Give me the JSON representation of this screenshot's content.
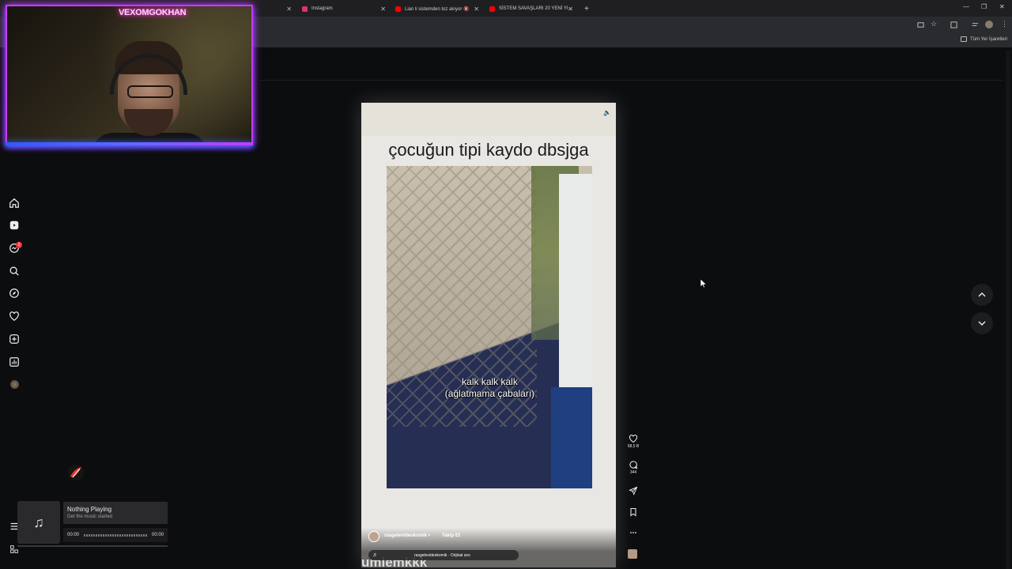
{
  "browser": {
    "tabs": [
      {
        "label": "Instagram",
        "color": "#e1306c"
      },
      {
        "label": "Lian li sistemden toz akıyor 🔇",
        "color": "#ff0000"
      },
      {
        "label": "SİSTEM SAVAŞLARI 20 YENİ YI...",
        "color": "#ff0000"
      }
    ],
    "new_tab": "+",
    "bookmarks_label": "Tüm Yer İşaretleri"
  },
  "webcam": {
    "title": "VEXOMGOKHAN"
  },
  "nav": {
    "items": [
      {
        "icon": "home-icon"
      },
      {
        "icon": "reels-icon"
      },
      {
        "icon": "messages-icon",
        "badge": "2"
      },
      {
        "icon": "search-icon"
      },
      {
        "icon": "explore-icon"
      },
      {
        "icon": "heart-icon"
      },
      {
        "icon": "create-icon"
      },
      {
        "icon": "dashboard-icon"
      },
      {
        "icon": "profile-avatar"
      }
    ],
    "more_icon": "menu-icon"
  },
  "music": {
    "title": "Nothing Playing",
    "subtitle": "Get the music started",
    "time_current": "00:00",
    "time_total": "00:00"
  },
  "reel": {
    "caption": "çocuğun tipi kaydo dbsjga",
    "subtitle_line1": "kalk kalk kalk",
    "subtitle_line2": "(ağlatmama çabaları)",
    "username": "rasgelevideokomik",
    "separator": "•",
    "follow": "Takip Et",
    "audio": "rasgelevideokomik · Orijinal ses",
    "bottom_text": "umlemkkk"
  },
  "actions": {
    "likes": "58,5 B",
    "comments": "344"
  }
}
